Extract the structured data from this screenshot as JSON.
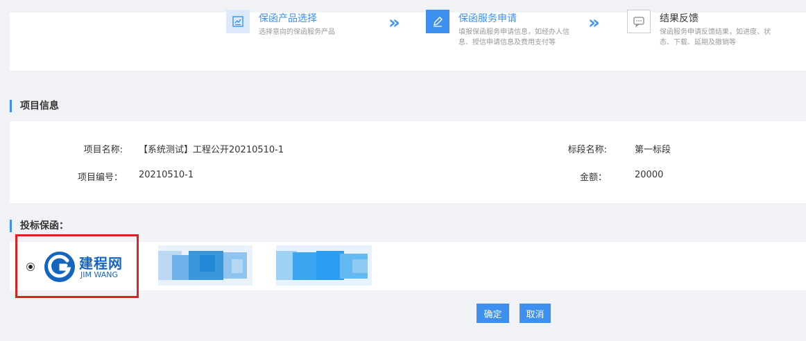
{
  "steps": [
    {
      "title": "保函产品选择",
      "desc": "选择意向的保函服务产品",
      "icon": "chart-document-icon"
    },
    {
      "title": "保函服务申请",
      "desc": "填报保函服务申请信息，如经办人信息、授信申请信息及费用支付等",
      "icon": "pencil-edit-icon"
    },
    {
      "title": "结果反馈",
      "desc": "保函服务申请反馈结果，如进度、状态、下载、延期及撤销等",
      "icon": "message-dots-icon"
    }
  ],
  "step_arrow": "»",
  "colors": {
    "accent": "#3d8ff0",
    "highlight": "#e02020",
    "logo": "#1565c0"
  },
  "project_section": {
    "title": "项目信息",
    "name_label": "项目名称:",
    "name_value": "【系统测试】工程公开20210510-1",
    "segment_label": "标段名称:",
    "segment_value": "第一标段",
    "code_label": "项目编号：",
    "code_value": "20210510-1",
    "amount_label": "金额：",
    "amount_value": "20000"
  },
  "bid_section": {
    "title": "投标保函：",
    "selected_provider": {
      "name_cn": "建程网",
      "name_en": "JIM WANG"
    }
  },
  "buttons": {
    "confirm": "确定",
    "cancel": "取消"
  }
}
